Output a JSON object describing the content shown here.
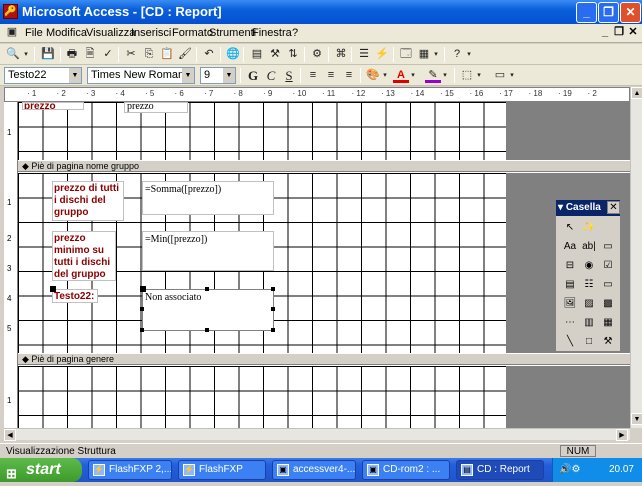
{
  "window": {
    "title": "Microsoft Access - [CD : Report]"
  },
  "menu": {
    "items": [
      "File",
      "Modifica",
      "Visualizza",
      "Inserisci",
      "Formato",
      "Strumenti",
      "Finestra",
      "?"
    ]
  },
  "format_toolbar": {
    "control": "Testo22",
    "font": "Times New Roman",
    "size": "9",
    "bold": "G",
    "italic": "C",
    "underline": "S"
  },
  "ruler": {
    "marks": [
      "1",
      "2",
      "3",
      "4",
      "5",
      "6",
      "7",
      "8",
      "9",
      "10",
      "11",
      "12",
      "13",
      "14",
      "15",
      "16",
      "17",
      "18",
      "19",
      "2"
    ]
  },
  "sections": {
    "footer_group": "Piè di pagina nome gruppo",
    "footer_genre": "Piè di pagina genere"
  },
  "controls": {
    "top_label": "prezzo",
    "top_field": "prezzo",
    "label_total": "prezzo di tutti i dischi del gruppo",
    "field_total": "=Somma([prezzo])",
    "label_min": "prezzo minimo su tutti i dischi del gruppo",
    "field_min": "=Min([prezzo])",
    "label_testo22": "Testo22:",
    "field_testo22": "Non associato"
  },
  "toolbox": {
    "title": "Casella",
    "tools": [
      "pointer",
      "wizard",
      "Aa",
      "ab|",
      "xyz",
      "toggle",
      "radio",
      "check",
      "combo",
      "list",
      "button",
      "image",
      "unbound-frame",
      "bound-frame",
      "page-break",
      "tab",
      "subform",
      "line",
      "rect",
      "more"
    ]
  },
  "status": {
    "left": "Visualizzazione Struttura",
    "num": "NUM"
  },
  "taskbar": {
    "start": "start",
    "tasks": [
      "FlashFXP 2,...",
      "FlashFXP",
      "accessver4-...",
      "CD-rom2 : ...",
      "CD : Report"
    ],
    "clock": "20.07"
  }
}
